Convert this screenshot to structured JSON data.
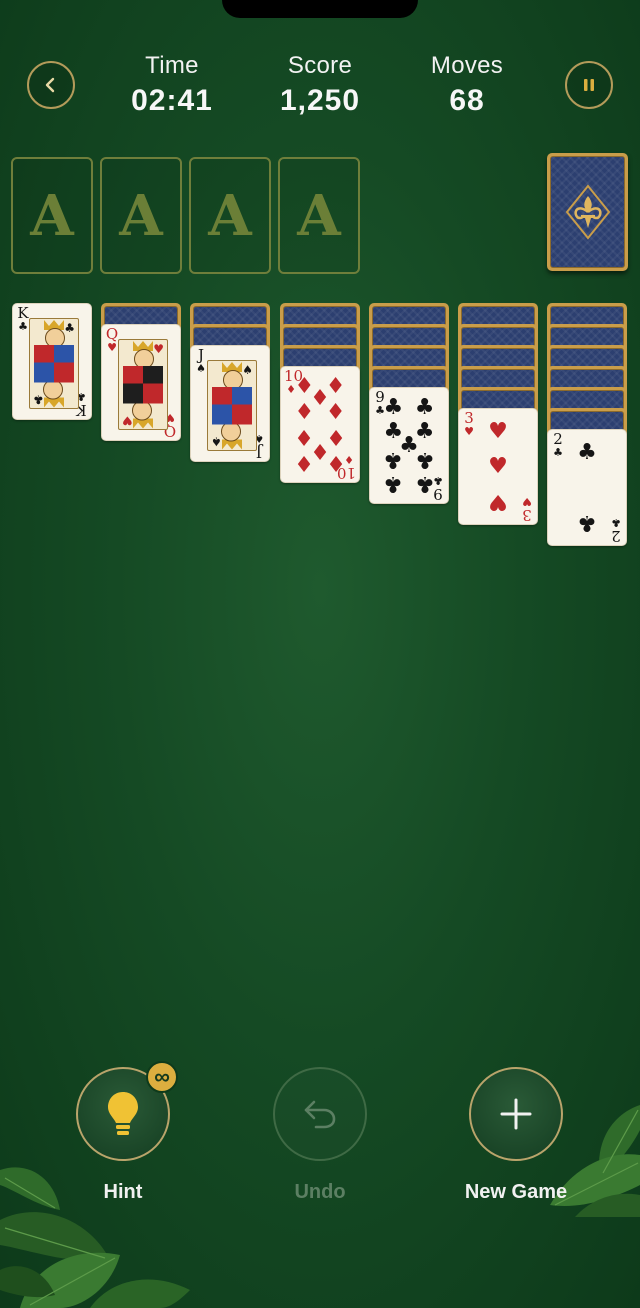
{
  "header": {
    "time_label": "Time",
    "time_value": "02:41",
    "score_label": "Score",
    "score_value": "1,250",
    "moves_label": "Moves",
    "moves_value": "68"
  },
  "foundations": [
    "A",
    "A",
    "A",
    "A"
  ],
  "tableau": [
    {
      "face_down": 0,
      "top": {
        "rank": "K",
        "suit": "♣",
        "color": "black"
      }
    },
    {
      "face_down": 1,
      "top": {
        "rank": "Q",
        "suit": "♥",
        "color": "red"
      }
    },
    {
      "face_down": 2,
      "top": {
        "rank": "J",
        "suit": "♠",
        "color": "black"
      }
    },
    {
      "face_down": 3,
      "top": {
        "rank": "10",
        "suit": "♦",
        "color": "red"
      }
    },
    {
      "face_down": 4,
      "top": {
        "rank": "9",
        "suit": "♣",
        "color": "black"
      }
    },
    {
      "face_down": 5,
      "top": {
        "rank": "3",
        "suit": "♥",
        "color": "red"
      }
    },
    {
      "face_down": 6,
      "top": {
        "rank": "2",
        "suit": "♣",
        "color": "black"
      }
    }
  ],
  "actions": {
    "hint_label": "Hint",
    "hint_badge": "∞",
    "undo_label": "Undo",
    "new_game_label": "New Game"
  },
  "icons": {
    "back": "chevron-left-icon",
    "pause": "pause-icon",
    "hint": "lightbulb-icon",
    "undo": "undo-arrow-icon",
    "new_game": "plus-icon",
    "stock": "fleur-de-lis-icon"
  },
  "colors": {
    "felt": "#154a24",
    "gold": "#b39b5a",
    "card_back": "#2c3f70",
    "red_suit": "#c0282b",
    "badge": "#dcae3f"
  }
}
